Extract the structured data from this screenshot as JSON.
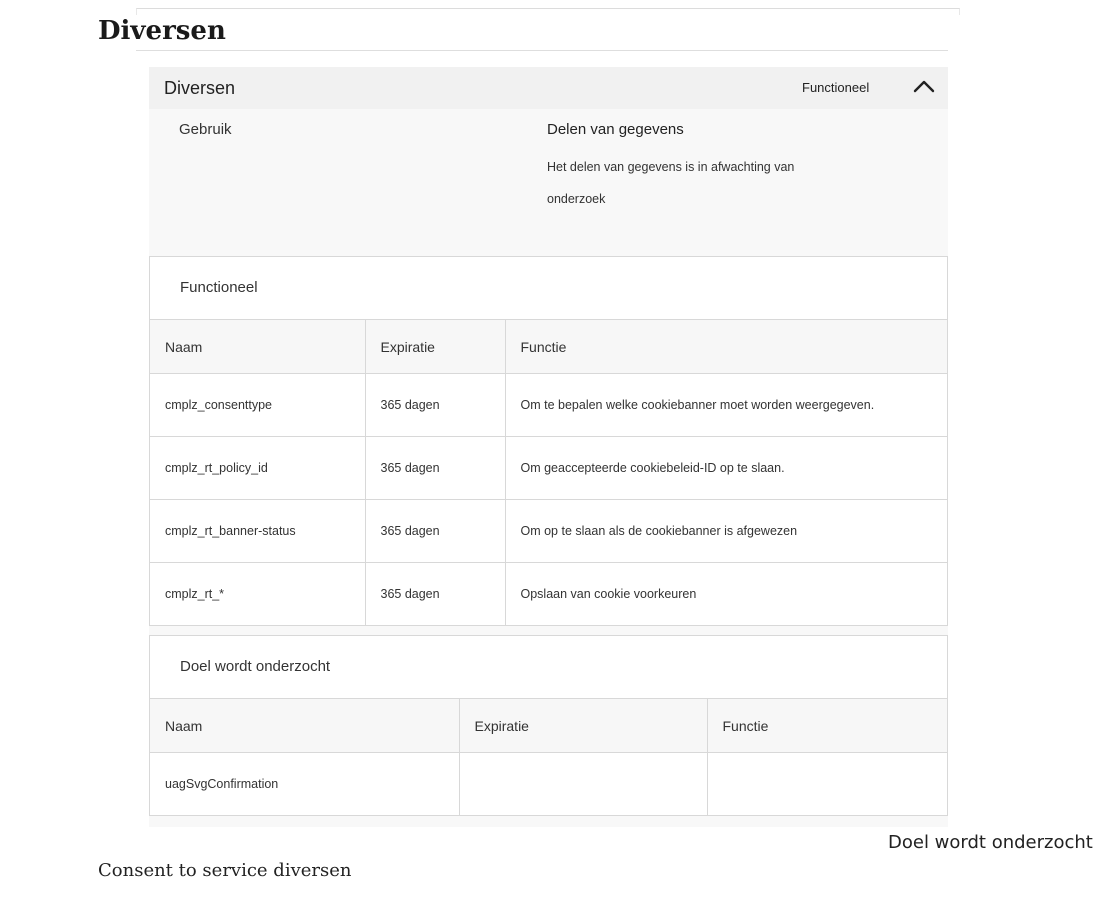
{
  "page": {
    "title": "Diversen",
    "purpose_label": "Doel wordt onderzocht",
    "consent_text": "Consent to service diversen"
  },
  "panel": {
    "title": "Diversen",
    "status": "Functioneel",
    "toggle_icon": "chevron-up-icon",
    "usage_label": "Gebruik",
    "sharing_title": "Delen van gegevens",
    "sharing_text": "Het delen van gegevens is in afwachting van onderzoek"
  },
  "functional": {
    "title": "Functioneel",
    "headers": [
      "Naam",
      "Expiratie",
      "Functie"
    ],
    "rows": [
      [
        "cmplz_consenttype",
        "365 dagen",
        "Om te bepalen welke cookiebanner moet worden weergegeven."
      ],
      [
        "cmplz_rt_policy_id",
        "365 dagen",
        "Om geaccepteerde cookiebeleid-ID op te slaan."
      ],
      [
        "cmplz_rt_banner-status",
        "365 dagen",
        "Om op te slaan als de cookiebanner is afgewezen"
      ],
      [
        "cmplz_rt_*",
        "365 dagen",
        "Opslaan van cookie voorkeuren"
      ]
    ]
  },
  "investigated": {
    "title": "Doel wordt onderzocht",
    "headers": [
      "Naam",
      "Expiratie",
      "Functie"
    ],
    "rows": [
      [
        "uagSvgConfirmation",
        "",
        ""
      ]
    ]
  }
}
